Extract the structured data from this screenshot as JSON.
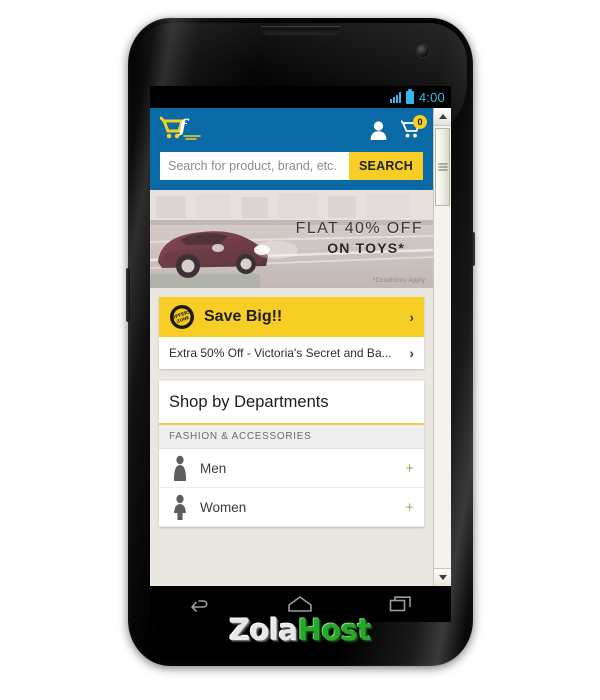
{
  "device": {
    "type": "android-phone",
    "statusbar": {
      "time": "4:00",
      "signal_icon": "signal-bars-icon",
      "battery_icon": "battery-full-icon"
    },
    "navbar": {
      "back_icon": "back-arrow-icon",
      "home_icon": "home-icon",
      "recents_icon": "recent-apps-icon"
    }
  },
  "app": {
    "header": {
      "logo_icon": "shopping-cart-f-logo",
      "account_icon": "user-account-icon",
      "cart_icon": "shopping-cart-icon",
      "cart_count": "0",
      "bg_color": "#0a6aa6"
    },
    "search": {
      "placeholder": "Search for product, brand, etc.",
      "value": "",
      "button_label": "SEARCH",
      "button_color": "#f6ce25"
    },
    "banner": {
      "headline": "FLAT 40% OFF",
      "subline": "ON TOYS*",
      "disclaimer": "*Conditions Apply",
      "image_alt": "sports-car-banner"
    },
    "offers": {
      "badge_icon": "offers-zone-badge",
      "save_big_label": "Save Big!!",
      "save_big_chevron": "›",
      "promo_label": "Extra 50% Off - Victoria's Secret and Ba...",
      "promo_chevron": "›",
      "highlight_color": "#f6ce25"
    },
    "departments": {
      "title": "Shop by Departments",
      "section_label": "FASHION & ACCESSORIES",
      "accent_color": "#f0c93d",
      "items": [
        {
          "label": "Men",
          "icon": "man-silhouette-icon",
          "expander": "+"
        },
        {
          "label": "Women",
          "icon": "woman-silhouette-icon",
          "expander": "+"
        }
      ]
    }
  },
  "browser": {
    "scrollbar": {
      "up_arrow_icon": "scroll-up-arrow-icon",
      "down_arrow_icon": "scroll-down-arrow-icon",
      "thumb_icon": "scrollbar-thumb"
    }
  },
  "watermark": {
    "part_one": "Zola",
    "part_two": "Host",
    "color_one": "#e8e8e8",
    "color_two": "#2aa62a"
  }
}
